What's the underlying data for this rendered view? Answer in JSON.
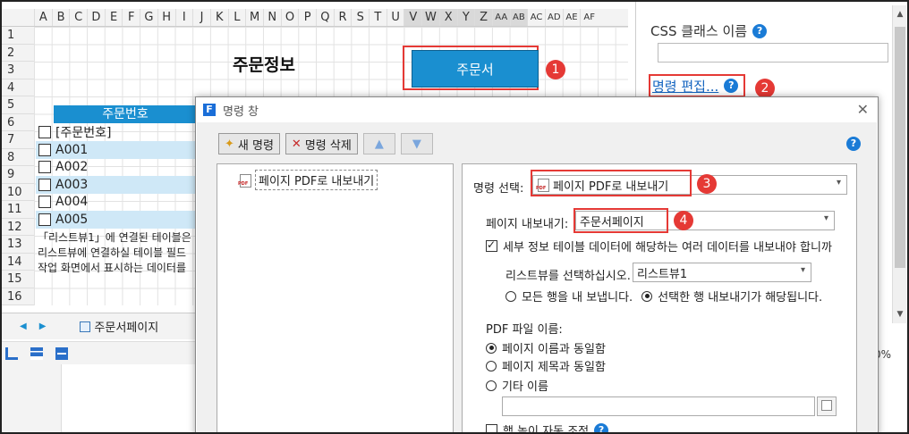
{
  "sheet": {
    "columns": [
      "A",
      "B",
      "C",
      "D",
      "E",
      "F",
      "G",
      "H",
      "I",
      "J",
      "K",
      "L",
      "M",
      "N",
      "O",
      "P",
      "Q",
      "R",
      "S",
      "T",
      "U",
      "V",
      "W",
      "X",
      "Y",
      "Z",
      "AA",
      "AB",
      "AC",
      "AD",
      "AE",
      "AF"
    ],
    "rows": [
      "1",
      "2",
      "3",
      "4",
      "5",
      "6",
      "7",
      "8",
      "9",
      "10",
      "11",
      "12",
      "13",
      "14",
      "15",
      "16"
    ],
    "title": "주문정보",
    "order_button": "주문서",
    "table_header": "주문번호",
    "table_rows": [
      "[주문번호]",
      "A001",
      "A002",
      "A003",
      "A004",
      "A005"
    ],
    "notes": [
      "「리스트뷰1」에 연결된 테이블은",
      "리스트뷰에 연결하실 테이블 필드",
      "작업 화면에서 표시하는 데이터를"
    ],
    "tab_label": "주문서페이지"
  },
  "badges": [
    "1",
    "2",
    "3",
    "4"
  ],
  "right_panel": {
    "css_label": "CSS 클래스 이름",
    "command_edit": "명령 편집...",
    "zoom_fragment": "0%"
  },
  "dialog": {
    "title": "명령 창",
    "new_command": "새 명령",
    "delete_command": "명령 삭제",
    "list_item": "페이지 PDF로 내보내기",
    "command_select_label": "명령 선택:",
    "command_select_value": "페이지 PDF로 내보내기",
    "page_export_label": "페이지 내보내기:",
    "page_export_value": "주문서페이지",
    "detail_checkbox": "세부 정보 테이블 데이터에 해당하는 여러 데이터를 내보내야 합니까",
    "listview_label": "리스트뷰를 선택하십시오.",
    "listview_value": "리스트뷰1",
    "radio_all_rows": "모든 행을 내 보냅니다.",
    "radio_selected_rows": "선택한 행 내보내기가 해당됩니다.",
    "pdf_name_label": "PDF 파일 이름:",
    "radio_same_page_name": "페이지 이름과 동일함",
    "radio_same_page_title": "페이지 제목과 동일함",
    "radio_other_name": "기타 이름",
    "row_height_auto": "행 높이 자동 조정"
  },
  "colors": {
    "accent": "#1a8fd0",
    "highlight_red": "#e53935",
    "row_alt": "#cfe8f7"
  }
}
